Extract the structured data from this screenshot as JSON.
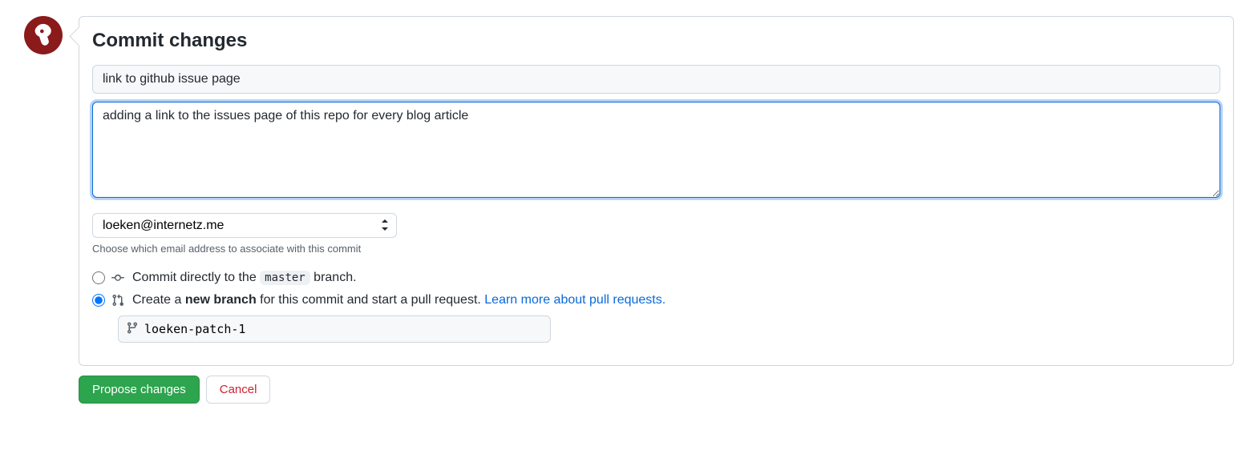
{
  "heading": "Commit changes",
  "commit_summary": "link to github issue page",
  "commit_description": "adding a link to the issues page of this repo for every blog article",
  "email_select": "loeken@internetz.me",
  "email_hint": "Choose which email address to associate with this commit",
  "radio_direct": {
    "prefix": "Commit directly to the ",
    "branch": "master",
    "suffix": " branch."
  },
  "radio_newbranch": {
    "prefix": "Create a ",
    "bold": "new branch",
    "suffix": " for this commit and start a pull request. ",
    "link": "Learn more about pull requests."
  },
  "branch_name": "loeken-patch-1",
  "buttons": {
    "propose": "Propose changes",
    "cancel": "Cancel"
  }
}
